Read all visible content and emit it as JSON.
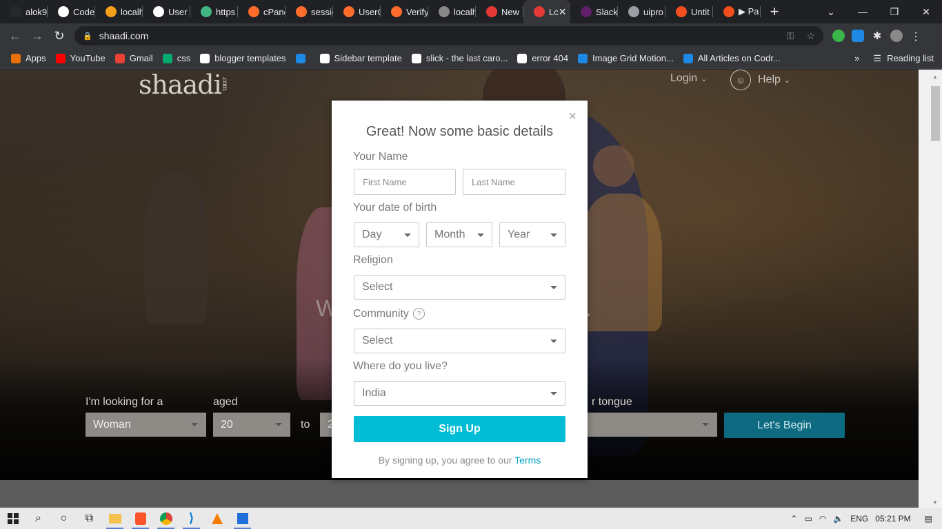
{
  "browser": {
    "tabs": [
      {
        "title": "alok9",
        "icon_color": "#24292e",
        "icon": "github-icon"
      },
      {
        "title": "Code",
        "icon_color": "#ffffff",
        "icon": "globe-icon"
      },
      {
        "title": "localh",
        "icon_color": "#f4a01c",
        "icon": "xampp-icon"
      },
      {
        "title": "User",
        "icon_color": "#ffffff",
        "icon": "globe-icon"
      },
      {
        "title": "https",
        "icon_color": "#41b883",
        "icon": "vue-icon"
      },
      {
        "title": "cPane",
        "icon_color": "#ff6c2c",
        "icon": "cpanel-icon"
      },
      {
        "title": "sessic",
        "icon_color": "#ff6c2c",
        "icon": "cpanel-icon"
      },
      {
        "title": "UserC",
        "icon_color": "#ff6c2c",
        "icon": "cpanel-icon"
      },
      {
        "title": "Verify",
        "icon_color": "#ff6c2c",
        "icon": "cpanel-icon"
      },
      {
        "title": "localh",
        "icon_color": "#888888",
        "icon": "react-icon"
      },
      {
        "title": "New",
        "icon_color": "#e53935",
        "icon": "js-icon"
      },
      {
        "title": "Lc",
        "icon_color": "#e53935",
        "icon": "shaadi-icon",
        "active": true
      },
      {
        "title": "Slack",
        "icon_color": "#611f69",
        "icon": "slack-icon"
      },
      {
        "title": "uipro",
        "icon_color": "#9aa0a6",
        "icon": "globe-icon"
      },
      {
        "title": "Untit",
        "icon_color": "#f24e1e",
        "icon": "figma-icon"
      },
      {
        "title": "▶ Pa",
        "icon_color": "#f24e1e",
        "icon": "figma-icon"
      }
    ],
    "url": "shaadi.com",
    "bookmarks": [
      {
        "label": "Apps",
        "icon": "apps-grid-icon",
        "color": "#e8710a"
      },
      {
        "label": "YouTube",
        "icon": "youtube-icon",
        "color": "#ff0000"
      },
      {
        "label": "Gmail",
        "icon": "gmail-icon",
        "color": "#ea4335"
      },
      {
        "label": "css",
        "icon": "w3-icon",
        "color": "#04aa6d"
      },
      {
        "label": "blogger templates",
        "icon": "f-icon",
        "color": "#ffffff"
      },
      {
        "label": "",
        "icon": "is-icon",
        "color": "#1e88e5"
      },
      {
        "label": "Sidebar template",
        "icon": "codepen-icon",
        "color": "#ffffff"
      },
      {
        "label": "slick - the last caro...",
        "icon": "globe-icon",
        "color": "#ffffff"
      },
      {
        "label": "error 404",
        "icon": "globe-icon",
        "color": "#ffffff"
      },
      {
        "label": "Image Grid Motion...",
        "icon": "codrops-icon",
        "color": "#1e88e5"
      },
      {
        "label": "All Articles on Codr...",
        "icon": "codrops-icon",
        "color": "#1e88e5"
      }
    ],
    "more_bookmarks": "»",
    "reading_list": "Reading list"
  },
  "site": {
    "logo": "shaadi",
    "logo_suffix": ".com",
    "login": "Login",
    "help": "Help",
    "tagline_left": "W",
    "tagline_right": "er.",
    "search": {
      "looking_label": "I'm looking for a",
      "looking_value": "Woman",
      "aged_label": "aged",
      "age_from": "20",
      "to_label": "to",
      "age_to": "2",
      "tongue_label": "r tongue",
      "begin": "Let's Begin"
    }
  },
  "modal": {
    "close": "×",
    "title": "Great! Now some basic details",
    "name_label": "Your Name",
    "first_name_placeholder": "First Name",
    "last_name_placeholder": "Last Name",
    "dob_label": "Your date of birth",
    "day": "Day",
    "month": "Month",
    "year": "Year",
    "religion_label": "Religion",
    "religion_value": "Select",
    "community_label": "Community",
    "community_help": "?",
    "community_value": "Select",
    "live_label": "Where do you live?",
    "live_value": "India",
    "signup": "Sign Up",
    "terms_text": "By signing up, you agree to our ",
    "terms_link": "Terms"
  },
  "taskbar": {
    "lang": "ENG",
    "time": "05:21 PM"
  }
}
